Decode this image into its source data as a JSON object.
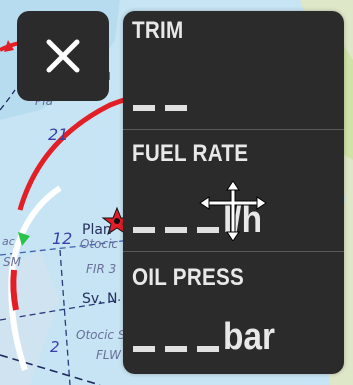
{
  "map": {
    "labels": [
      {
        "text": "21"
      },
      {
        "text": "12"
      },
      {
        "text": "Plan"
      },
      {
        "text": "Otocic"
      },
      {
        "text": "FIR 3"
      },
      {
        "text": "Sv. N"
      },
      {
        "text": "Otocic S"
      },
      {
        "text": "FLW"
      },
      {
        "text": "2"
      },
      {
        "text": "Pla"
      },
      {
        "text": "SM"
      },
      {
        "text": "ac"
      }
    ]
  },
  "close_button": {
    "icon": "close-icon"
  },
  "widgets": [
    {
      "label": "TRIM",
      "value": "--",
      "dash_count": 2,
      "unit": ""
    },
    {
      "label": "FUEL RATE",
      "value": "---",
      "dash_count": 3,
      "unit": "l/h"
    },
    {
      "label": "OIL PRESS",
      "value": "---",
      "dash_count": 3,
      "unit": "bar"
    }
  ],
  "cursor": {
    "icon": "move-cursor-icon"
  },
  "colors": {
    "panel_bg": "#2b2b2b",
    "text": "#e8e8e8",
    "map_sea": "#c8e6f5",
    "route_red": "#e21f26",
    "range_white": "#ffffff"
  }
}
